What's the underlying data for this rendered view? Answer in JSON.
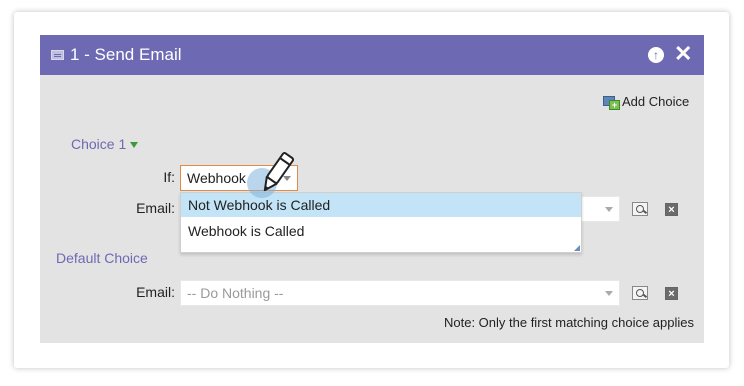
{
  "dialog": {
    "title": "1 - Send Email",
    "add_choice_label": "Add Choice",
    "choice1": {
      "heading": "Choice 1",
      "if_label": "If:",
      "if_value": "Webhook",
      "email_label": "Email:"
    },
    "dropdown": {
      "options": [
        "Not Webhook is Called",
        "Webhook is Called"
      ],
      "highlighted": "Not Webhook is Called"
    },
    "default_choice": {
      "heading": "Default Choice",
      "email_label": "Email:",
      "email_value": "-- Do Nothing --"
    },
    "note": "Note: Only the first matching choice applies"
  },
  "icons": {
    "title": "email-card-icon",
    "move_up": "arrow-up-circle-icon",
    "close": "close-icon",
    "add_choice": "add-choice-icon",
    "search": "search-icon",
    "remove": "remove-icon",
    "cursor": "pencil-cursor-icon"
  },
  "colors": {
    "titlebar": "#6e69b3",
    "panel": "#e3e3e3",
    "accent_text": "#6e69b3",
    "highlight": "#c2e4f6",
    "focus_border": "#e08a4a"
  }
}
